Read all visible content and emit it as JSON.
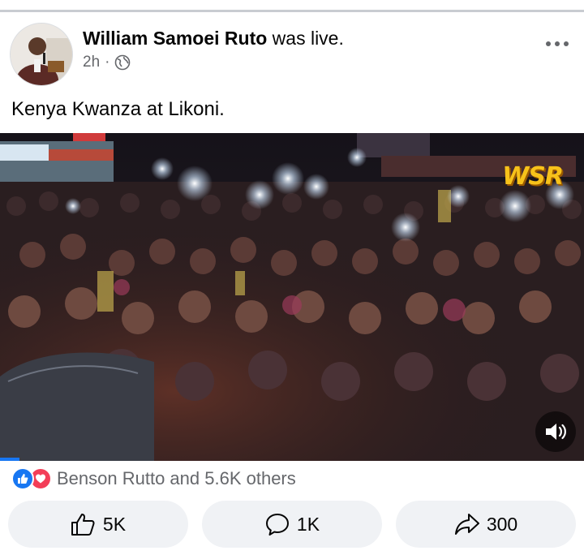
{
  "post": {
    "author": "William Samoei Ruto",
    "verb": "was live.",
    "time": "2h",
    "separator": "·",
    "privacy_icon": "globe-icon",
    "text": "Kenya Kwanza at Likoni."
  },
  "video": {
    "watermark": "WSR",
    "sound_icon": "speaker-icon"
  },
  "reactions": {
    "icons": [
      "like-icon",
      "love-icon"
    ],
    "summary": "Benson Rutto and 5.6K others"
  },
  "actions": {
    "like_count": "5K",
    "comment_count": "1K",
    "share_count": "300"
  },
  "colors": {
    "accent": "#1877f2",
    "love": "#f33e58",
    "secondary_text": "#65676b",
    "button_bg": "#f0f2f5"
  }
}
